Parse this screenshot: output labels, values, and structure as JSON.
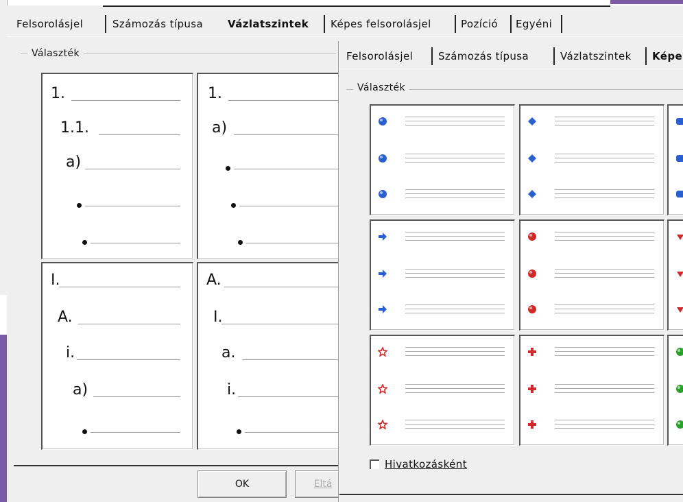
{
  "back_dialog": {
    "tabs": [
      {
        "label": "Felsorolásjel"
      },
      {
        "label": "Számozás típusa"
      },
      {
        "label": "Vázlatszintek"
      },
      {
        "label": "Képes felsorolásjel"
      },
      {
        "label": "Pozíció"
      },
      {
        "label": "Egyéni"
      }
    ],
    "active_tab": "Vázlatszintek",
    "group_label": "Választék",
    "presets": [
      {
        "labels": [
          "1.",
          "1.1.",
          "a)",
          "",
          ""
        ]
      },
      {
        "labels": [
          "1.",
          "a)",
          "",
          "",
          ""
        ]
      },
      {
        "labels": [
          "I.",
          "A.",
          "i.",
          "a)",
          ""
        ]
      },
      {
        "labels": [
          "A.",
          "I.",
          "a.",
          "i.",
          ""
        ]
      }
    ],
    "ok_label": "OK",
    "cancel_label": "Eltá"
  },
  "front_dialog": {
    "tabs": [
      {
        "label": "Felsorolásjel"
      },
      {
        "label": "Számozás típusa"
      },
      {
        "label": "Vázlatszintek"
      },
      {
        "label": "Képe"
      }
    ],
    "active_tab": "Képe",
    "group_label": "Választék",
    "checkbox_label": "Hivatkozásként",
    "checkbox_checked": false,
    "graphic_bullets": [
      [
        "blue-sphere",
        "blue-diamond-arrow",
        "blue-square"
      ],
      [
        "blue-arrow",
        "red-sphere",
        "red-down-arrow"
      ],
      [
        "red-star",
        "red-cross",
        "green-sphere"
      ]
    ],
    "colors": {
      "blue": "#2a5fd0",
      "red": "#d02a2a",
      "green": "#2aa02a"
    }
  },
  "background": {
    "accent": "#7a5aa5"
  }
}
